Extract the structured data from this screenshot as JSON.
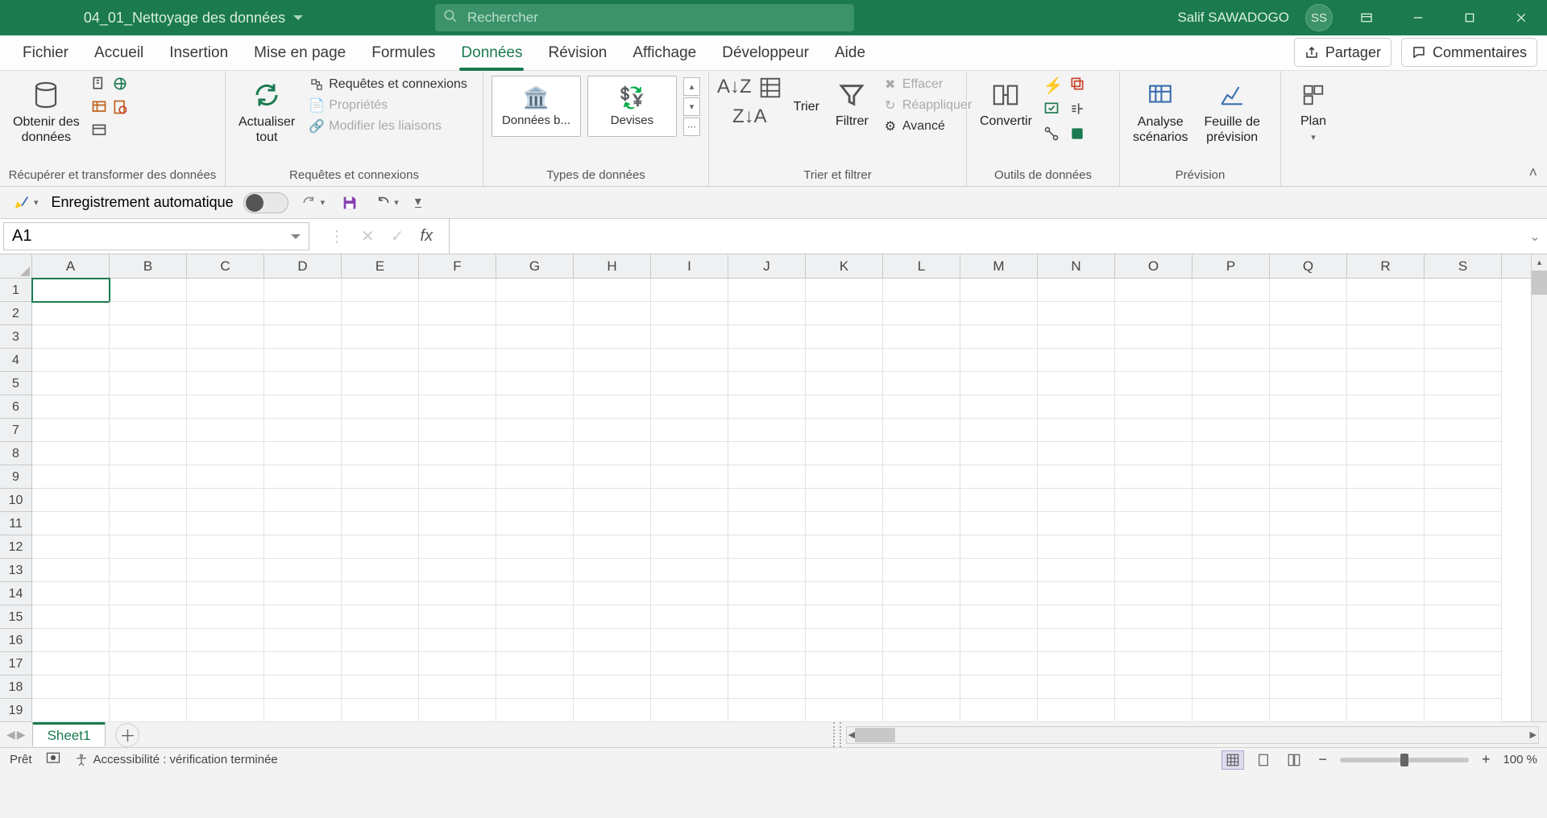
{
  "title": {
    "document": "04_01_Nettoyage des données"
  },
  "search": {
    "placeholder": "Rechercher"
  },
  "user": {
    "name": "Salif SAWADOGO",
    "initials": "SS"
  },
  "tabs": {
    "items": [
      "Fichier",
      "Accueil",
      "Insertion",
      "Mise en page",
      "Formules",
      "Données",
      "Révision",
      "Affichage",
      "Développeur",
      "Aide"
    ],
    "active": "Données",
    "share": "Partager",
    "comments": "Commentaires"
  },
  "ribbon": {
    "g1": {
      "get_data": "Obtenir des\ndonnées",
      "label": "Récupérer et transformer des données"
    },
    "g2": {
      "refresh": "Actualiser\ntout",
      "queries": "Requêtes et connexions",
      "props": "Propriétés",
      "links": "Modifier les liaisons",
      "label": "Requêtes et connexions"
    },
    "g3": {
      "tile1": "Données b...",
      "tile2": "Devises",
      "label": "Types de données"
    },
    "g4": {
      "sort": "Trier",
      "filter": "Filtrer",
      "clear": "Effacer",
      "reapply": "Réappliquer",
      "adv": "Avancé",
      "label": "Trier et filtrer"
    },
    "g5": {
      "convert": "Convertir",
      "label": "Outils de données"
    },
    "g6": {
      "whatif": "Analyse\nscénarios",
      "forecast": "Feuille de\nprévision",
      "label": "Prévision"
    },
    "g7": {
      "plan": "Plan"
    }
  },
  "qat": {
    "autosave": "Enregistrement automatique"
  },
  "namebox": {
    "value": "A1"
  },
  "grid": {
    "cols": [
      "A",
      "B",
      "C",
      "D",
      "E",
      "F",
      "G",
      "H",
      "I",
      "J",
      "K",
      "L",
      "M",
      "N",
      "O",
      "P",
      "Q",
      "R",
      "S"
    ],
    "rows": 19
  },
  "sheets": {
    "active": "Sheet1"
  },
  "status": {
    "ready": "Prêt",
    "a11y": "Accessibilité : vérification terminée",
    "zoom": "100 %"
  }
}
